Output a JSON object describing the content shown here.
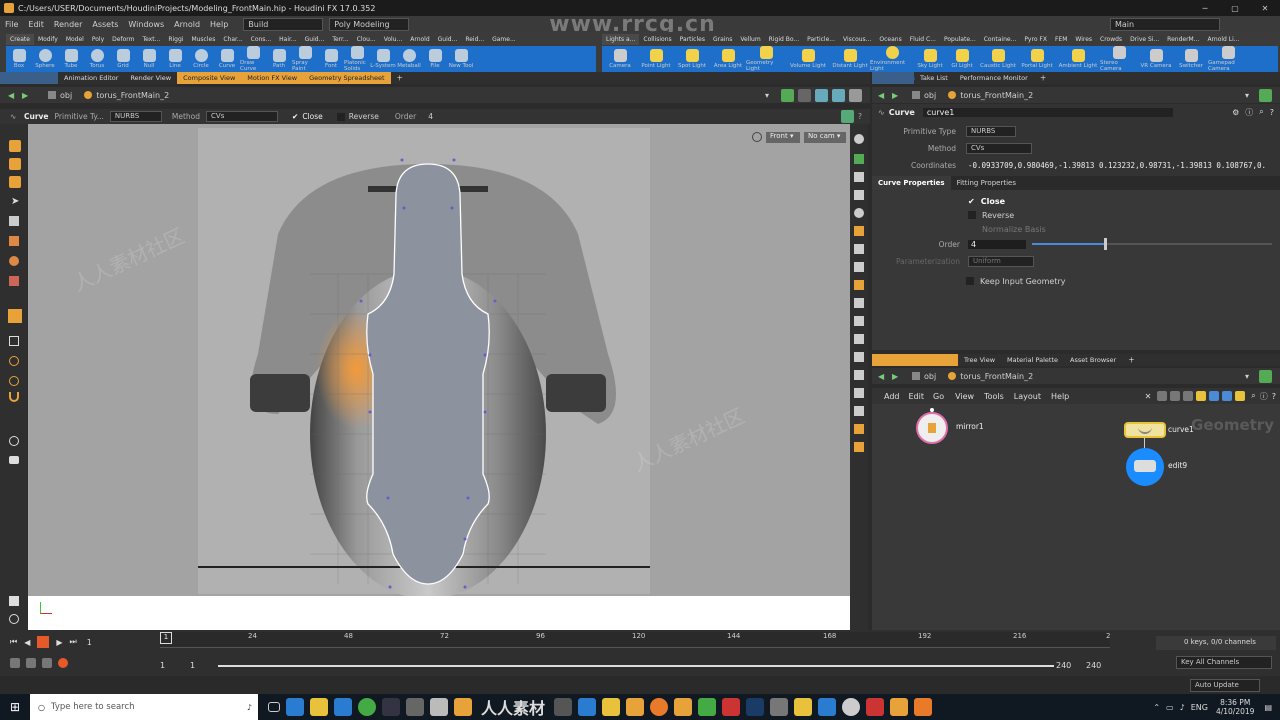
{
  "window": {
    "title": "C:/Users/USER/Documents/HoudiniProjects/Modeling_FrontMain.hip - Houdini FX 17.0.352",
    "desktop": "Main"
  },
  "menu": [
    "File",
    "Edit",
    "Render",
    "Assets",
    "Windows",
    "Arnold",
    "Help"
  ],
  "build_label": "Build",
  "poly_label": "Poly Modeling",
  "shelf_tabs_left": [
    "Create",
    "Modify",
    "Model",
    "Poly",
    "Deform",
    "Text...",
    "Riggi",
    "Muscles",
    "Char...",
    "Cons...",
    "Hair...",
    "Guid...",
    "Terr...",
    "Clou...",
    "Volu...",
    "Arnold",
    "Guid...",
    "Reid...",
    "Game..."
  ],
  "shelf_tools_left": [
    "Box",
    "Sphere",
    "Tube",
    "Torus",
    "Grid",
    "Null",
    "Line",
    "Circle",
    "Curve",
    "Draw Curve",
    "Path",
    "Spray Paint",
    "Font",
    "Platonic Solids",
    "L-System",
    "Metaball",
    "File",
    "New Tool"
  ],
  "shelf_tabs_right": [
    "Lights a...",
    "Collisions",
    "Particles",
    "Grains",
    "Vellum",
    "Rigid Bo...",
    "Particle...",
    "Viscous...",
    "Oceans",
    "Fluid C...",
    "Populate...",
    "Containe...",
    "Pyro FX",
    "FEM",
    "Wires",
    "Crowds",
    "Drive Si...",
    "RenderM...",
    "Arnold Li..."
  ],
  "shelf_tools_right": [
    "Camera",
    "Point Light",
    "Spot Light",
    "Area Light",
    "Geometry Light",
    "Volume Light",
    "Distant Light",
    "Environment Light",
    "Sky Light",
    "GI Light",
    "Caustic Light",
    "Portal Light",
    "Ambient Light",
    "Stereo Camera",
    "VR Camera",
    "Switcher",
    "Gamepad Camera"
  ],
  "left_pane_tabs": [
    "Scene View",
    "Animation Editor",
    "Render View",
    "Composite View",
    "Motion FX View",
    "Geometry Spreadsheet"
  ],
  "right_top_tabs": [
    "Parameters",
    "Take List",
    "Performance Monitor"
  ],
  "path": {
    "root": "obj",
    "node": "torus_FrontMain_2"
  },
  "viewport_ops": {
    "tool": "Curve",
    "prim_label": "Primitive Ty...",
    "prim_value": "NURBS",
    "method_label": "Method",
    "method_value": "CVs",
    "close": "Close",
    "reverse": "Reverse",
    "order_label": "Order",
    "order_value": "4"
  },
  "viewport": {
    "view": "Front",
    "cam": "No cam"
  },
  "params": {
    "type": "Curve",
    "name": "curve1",
    "prim_label": "Primitive Type",
    "prim_value": "NURBS",
    "method_label": "Method",
    "method_value": "CVs",
    "coords_label": "Coordinates",
    "coords_value": "-0.0933709,0.980469,-1.39813 0.123232,0.98731,-1.39813 0.108767,0.",
    "tab1": "Curve Properties",
    "tab2": "Fitting Properties",
    "close": "Close",
    "reverse": "Reverse",
    "normalize": "Normalize Basis",
    "order_label": "Order",
    "order_value": "4",
    "param_label": "Parameterization",
    "param_value": "Uniform",
    "keep": "Keep Input Geometry",
    "order_fill": 0.3
  },
  "network_tabs": [
    "Network View",
    "Tree View",
    "Material Palette",
    "Asset Browser"
  ],
  "network_menu": [
    "Add",
    "Edit",
    "Go",
    "View",
    "Tools",
    "Layout",
    "Help"
  ],
  "nodes": {
    "mirror": "mirror1",
    "curve": "curve1",
    "edit": "edit9",
    "context": "Geometry"
  },
  "timeline": {
    "ticks": [
      "24",
      "48",
      "72",
      "96",
      "120",
      "144",
      "168",
      "192",
      "216",
      "2"
    ],
    "frame": "1",
    "start": "1",
    "start2": "1",
    "end": "240",
    "end2": "240",
    "keys": "0 keys, 0/0 channels",
    "key_all": "Key All Channels",
    "auto": "Auto Update"
  },
  "taskbar": {
    "search": "Type here to search",
    "lang": "ENG",
    "time": "8:36 PM",
    "date": "4/10/2019"
  },
  "watermark": {
    "site": "www.rrcg.cn",
    "brand": "人人素材",
    "overlay": "人人素材社区"
  },
  "colors": {
    "accent": "#e8a23a",
    "shelf_blue": "#1e6fc9",
    "node_pink": "#e06fa8"
  }
}
